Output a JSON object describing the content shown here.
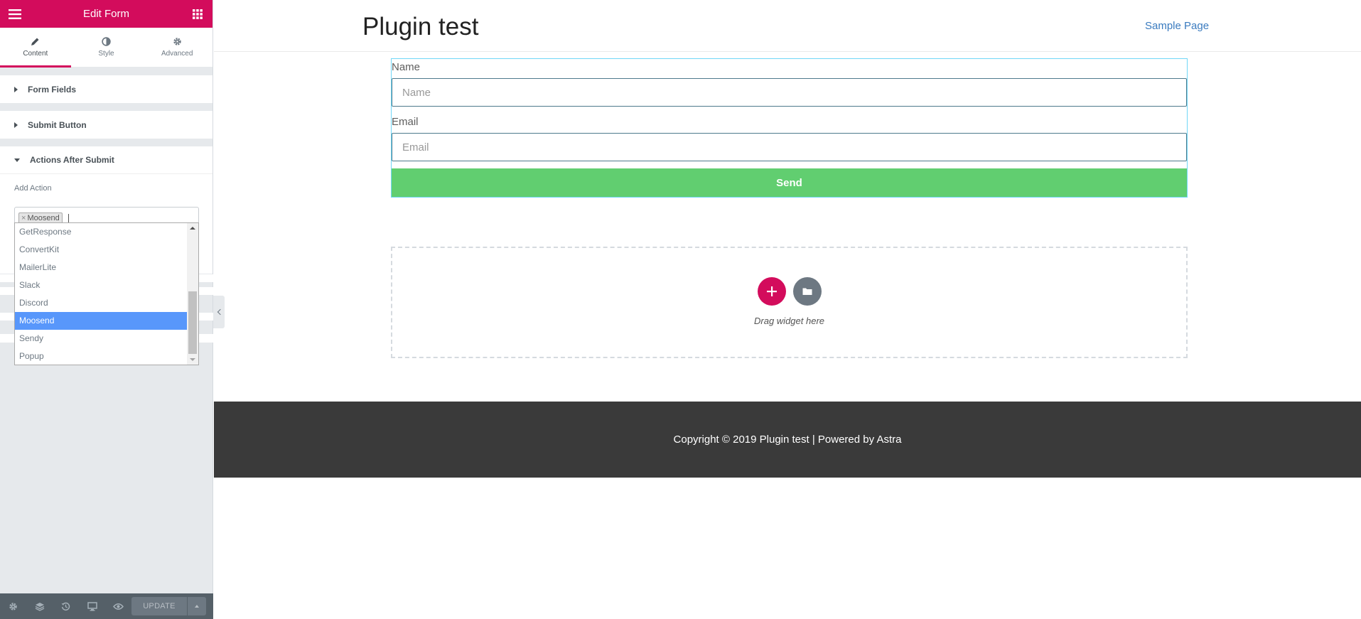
{
  "panel": {
    "title": "Edit Form",
    "tabs": [
      {
        "label": "Content",
        "icon": "pencil-icon"
      },
      {
        "label": "Style",
        "icon": "contrast-icon"
      },
      {
        "label": "Advanced",
        "icon": "gear-icon"
      }
    ],
    "sections": {
      "form_fields": "Form Fields",
      "submit_button": "Submit Button",
      "actions_after_submit": "Actions After Submit"
    },
    "add_action": {
      "label": "Add Action",
      "selected_chip": "Moosend",
      "chip_remove": "×"
    },
    "dropdown_options": [
      {
        "label": "GetResponse",
        "selected": false
      },
      {
        "label": "ConvertKit",
        "selected": false
      },
      {
        "label": "MailerLite",
        "selected": false
      },
      {
        "label": "Slack",
        "selected": false
      },
      {
        "label": "Discord",
        "selected": false
      },
      {
        "label": "Moosend",
        "selected": true
      },
      {
        "label": "Sendy",
        "selected": false
      },
      {
        "label": "Popup",
        "selected": false
      }
    ],
    "footer": {
      "update_label": "UPDATE"
    },
    "colors": {
      "brand": "#d30c5c",
      "selected_option": "#5897fb"
    }
  },
  "preview": {
    "site_title": "Plugin test",
    "nav_link": "Sample Page",
    "form": {
      "name_label": "Name",
      "name_placeholder": "Name",
      "email_label": "Email",
      "email_placeholder": "Email",
      "submit_label": "Send"
    },
    "drop_zone_text": "Drag widget here",
    "footer_text": "Copyright © 2019 Plugin test | Powered by Astra",
    "colors": {
      "send_button": "#61ce70",
      "footer_bg": "#3a3a3a"
    }
  }
}
